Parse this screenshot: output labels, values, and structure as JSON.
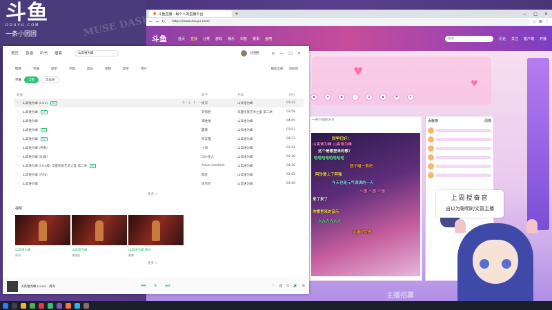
{
  "stream_logo": {
    "mark": "斗鱼",
    "sub": "DOUYU.COM",
    "tag": "一条小团团"
  },
  "stamps": {
    "muse": "MUSE DASH"
  },
  "browser": {
    "tab_title": "斗鱼直播 - 每个人的直播平台",
    "new_tab": "+",
    "url": "https://www.douyu.com/",
    "win_controls": [
      "—",
      "□",
      "✕"
    ]
  },
  "douyu": {
    "logo": "斗鱼",
    "nav": [
      "首页",
      "直播",
      "分类",
      "游戏",
      "娱乐",
      "科技",
      "赛事",
      "鱼吧"
    ],
    "search_placeholder": "搜索",
    "header_icons": [
      "历史",
      "关注",
      "客户端",
      "开播"
    ],
    "player_header": "一条小团团OvO",
    "rank_title": "贡献榜",
    "rank_tab": "周榜",
    "danmaku": [
      {
        "text": "同学们好！",
        "color": "#ffe25a"
      },
      {
        "text": "山高谁为峰 山高谁为峰",
        "color": "#ff7ad9"
      },
      {
        "text": "这个是哪里来的歌？",
        "color": "#ffffff"
      },
      {
        "text": "哈哈哈哈哈哈哈哈",
        "color": "#7dffb3"
      },
      {
        "text": "团子唱一首吧",
        "color": "#ff9b4a"
      },
      {
        "text": "阿珍爱上了阿强",
        "color": "#ffe25a"
      },
      {
        "text": "今天也是元气满满的一天",
        "color": "#8fd0ff"
      },
      {
        "text": "三国 三国 三国",
        "color": "#ff7ad9"
      },
      {
        "text": "来了来了",
        "color": "#ffffff"
      },
      {
        "text": "你哪里来的音乐",
        "color": "#ffe25a"
      },
      {
        "text": "六六六六六六",
        "color": "#7dffb3"
      },
      {
        "text": "主播好可爱",
        "color": "#ff9b4a"
      }
    ]
  },
  "music": {
    "tabs": [
      "首页",
      "直播",
      "听书",
      "播客"
    ],
    "search_value": "山高谁为峰",
    "user_name": "小团团",
    "win_controls": [
      "≡",
      "—",
      "□",
      "✕"
    ],
    "categories": [
      "综合",
      "单曲",
      "歌单",
      "专辑",
      "歌词",
      "视频",
      "歌手",
      "用户"
    ],
    "right_actions": [
      "播放全部",
      "添加到"
    ],
    "filters": [
      "单曲",
      "全部",
      "高品质"
    ],
    "table_headers": {
      "title": "歌曲",
      "artist": "歌手",
      "album": "专辑",
      "duration": "时长"
    },
    "songs": [
      {
        "title": "山高谁为峰 (Live)",
        "artist": "周深",
        "album": "山高谁为峰",
        "duration": "03:42",
        "badge": "MV"
      },
      {
        "title": "山高谁为峰",
        "artist": "刘惜君",
        "album": "华夏民族艺术之宴 第二季",
        "duration": "03:58",
        "badge": "VIP"
      },
      {
        "title": "山高谁为峰",
        "artist": "谭维维",
        "album": "山高谁为峰",
        "duration": "04:05",
        "badge": ""
      },
      {
        "title": "山高谁为峰",
        "artist": "霍尊",
        "album": "山高谁为峰",
        "duration": "03:51",
        "badge": "SQ"
      },
      {
        "title": "山高谁为峰",
        "artist": "阿云嘎",
        "album": "山高谁为峰",
        "duration": "04:12",
        "badge": "VIP"
      },
      {
        "title": "山高谁为峰 (伴奏)",
        "artist": "小海",
        "album": "山高谁为峰",
        "duration": "03:42",
        "badge": ""
      },
      {
        "title": "山高谁为峰 (DJ版)",
        "artist": "DJ小鱼儿",
        "album": "山高谁为峰",
        "duration": "03:30",
        "badge": ""
      },
      {
        "title": "山高谁为峰 (Live版) 华夏民族艺术之宴 第二季",
        "artist": "Adam Lambert",
        "album": "山高谁为峰",
        "duration": "04:20",
        "badge": "MV"
      },
      {
        "title": "山高谁为峰 (片段)",
        "artist": "群星",
        "album": "山高谁为峰",
        "duration": "01:02",
        "badge": ""
      },
      {
        "title": "山高谁为峰",
        "artist": "周杰伦",
        "album": "山高谁为峰",
        "duration": "03:46",
        "badge": ""
      }
    ],
    "more_songs": "更多 >",
    "videos_title": "视频",
    "videos": [
      {
        "caption": "山高谁为峰",
        "sub": "周深"
      },
      {
        "caption": "山高谁为峰",
        "sub": "谭维维"
      },
      {
        "caption": "山高谁为峰 舞台",
        "sub": "霍尊"
      }
    ],
    "more_videos": "更多 >",
    "now_playing": "山高谁为峰 (Live) - 周深",
    "controls": [
      "⏮",
      "⏸",
      "⏭"
    ],
    "right_controls": [
      "♡",
      "词",
      "⇆",
      "🔊",
      "☰"
    ]
  },
  "overlay": {
    "subtitle_line1": "上周授奋官",
    "subtitle_line2": "自以为聪明的文盲主播",
    "footer": "主播招募"
  },
  "taskbar": {
    "clock": ""
  },
  "colors": {
    "accent": "#2fc37a",
    "douyu": "#c74c9a",
    "taskbar": "#1b1e2b"
  }
}
